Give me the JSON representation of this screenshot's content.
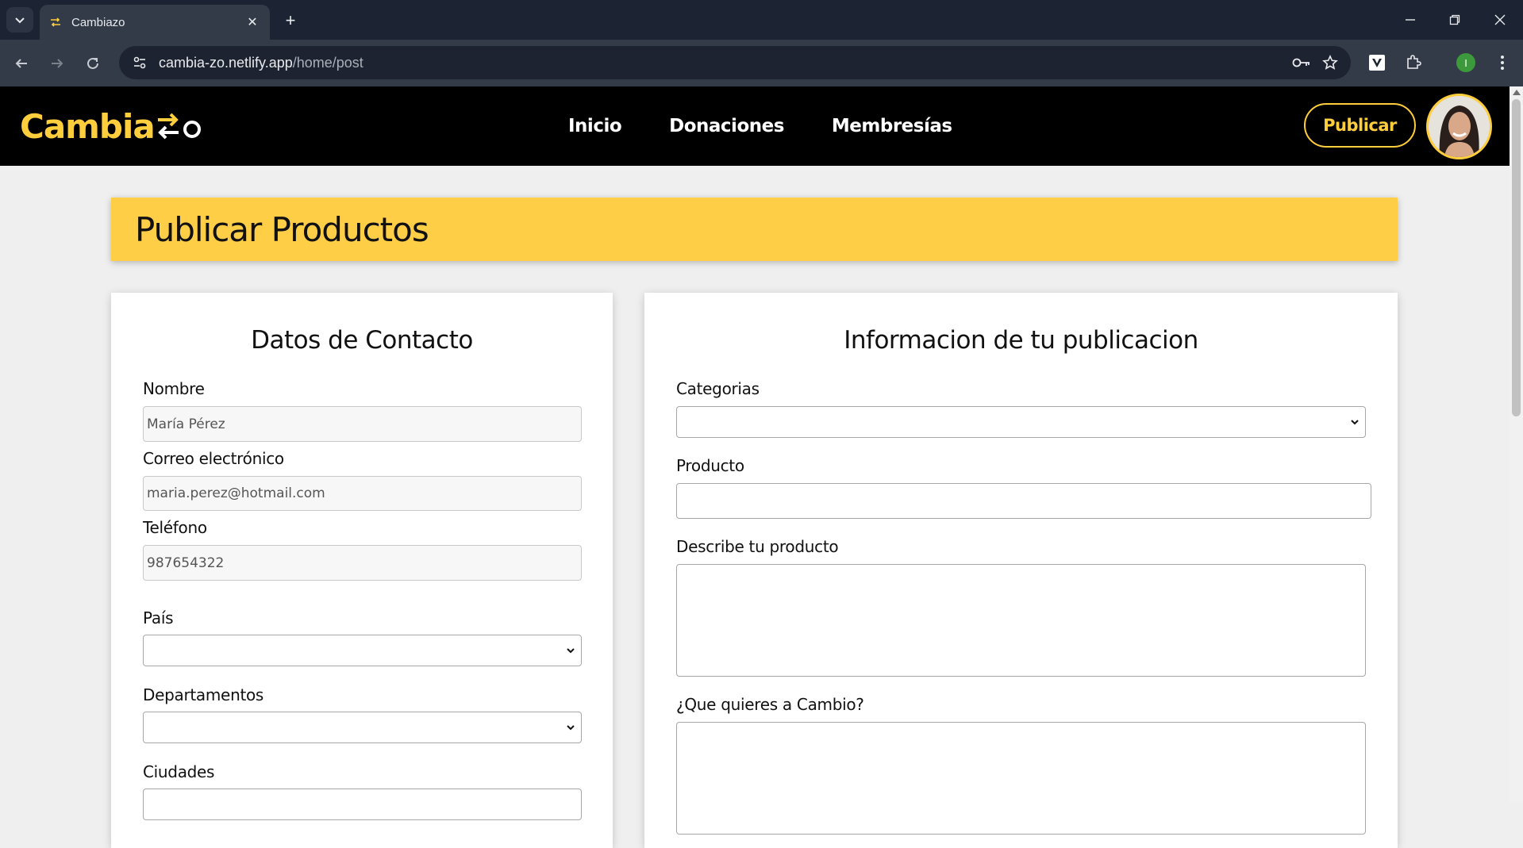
{
  "browser": {
    "tab_title": "Cambiazo",
    "url_host": "cambia-zo.netlify.app",
    "url_path": "/home/post",
    "profile_initial": "I"
  },
  "header": {
    "logo_text": "Cambia",
    "nav": [
      "Inicio",
      "Donaciones",
      "Membresías"
    ],
    "publish_label": "Publicar"
  },
  "page": {
    "title": "Publicar Productos"
  },
  "contact": {
    "heading": "Datos de Contacto",
    "name_label": "Nombre",
    "name_value": "María Pérez",
    "email_label": "Correo electrónico",
    "email_value": "maria.perez@hotmail.com",
    "phone_label": "Teléfono",
    "phone_value": "987654322",
    "country_label": "País",
    "department_label": "Departamentos",
    "city_label": "Ciudades"
  },
  "publication": {
    "heading": "Informacion de tu publicacion",
    "category_label": "Categorias",
    "product_label": "Producto",
    "description_label": "Describe tu producto",
    "exchange_label": "¿Que quieres a Cambio?"
  },
  "colors": {
    "brand_yellow": "#ffce47",
    "header_bg": "#000000",
    "chrome_bg": "#343b48"
  }
}
